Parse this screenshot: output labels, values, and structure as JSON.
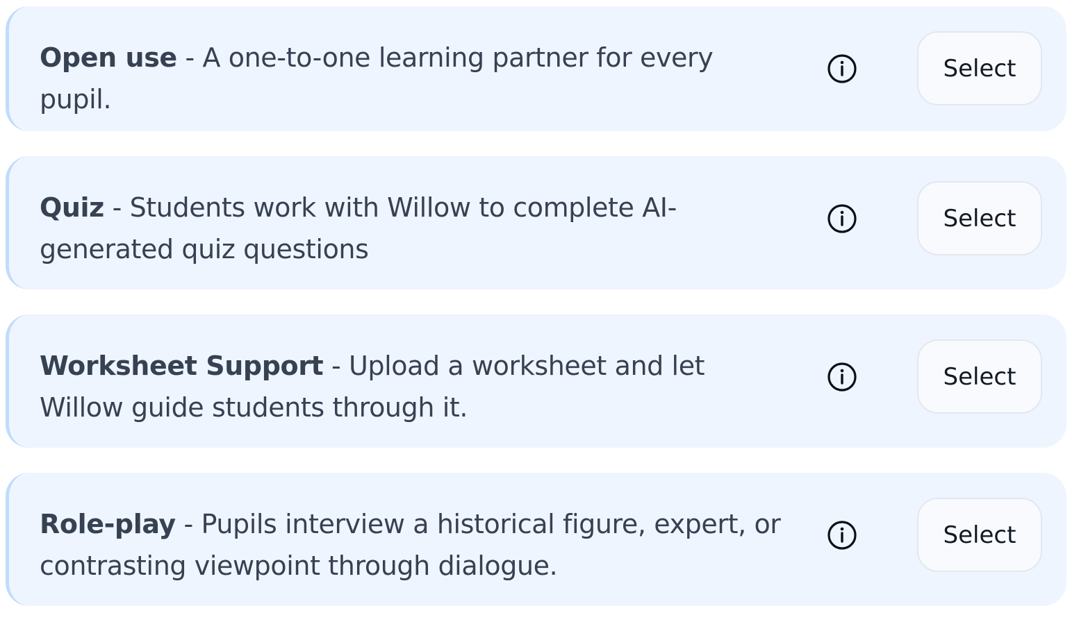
{
  "modes": [
    {
      "name": "Open use",
      "separator": " - ",
      "description": "A one-to-one learning partner for every pupil.",
      "info_icon": "info-circle-icon",
      "select_label": "Select"
    },
    {
      "name": "Quiz",
      "separator": " - ",
      "description": "Students work with Willow to complete AI-generated quiz questions",
      "info_icon": "info-circle-icon",
      "select_label": "Select"
    },
    {
      "name": "Worksheet Support",
      "separator": " - ",
      "description": "Upload a worksheet and let Willow guide students through it.",
      "info_icon": "info-circle-icon",
      "select_label": "Select"
    },
    {
      "name": "Role-play",
      "separator": " - ",
      "description": "Pupils interview a historical figure, expert, or contrasting viewpoint through dialogue.",
      "info_icon": "info-circle-icon",
      "select_label": "Select"
    }
  ],
  "colors": {
    "card_background": "#eff5ff",
    "card_accent": "#bfdcfc",
    "text": "#364152",
    "button_border": "#e3e8ef"
  }
}
